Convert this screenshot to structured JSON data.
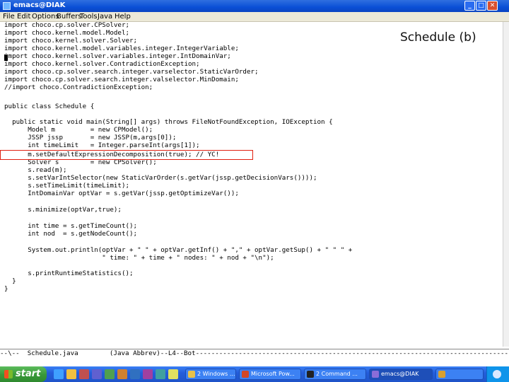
{
  "window": {
    "title": "emacs@DIAK",
    "buttons": [
      "_",
      "□",
      "✕"
    ]
  },
  "menu": {
    "items": [
      "File",
      "Edit",
      "Options",
      "Buffers",
      "Tools",
      "Java",
      "Help"
    ]
  },
  "caption": "Schedule (b)",
  "code": {
    "lines": [
      "import choco.cp.solver.CPSolver;",
      "import choco.kernel.model.Model;",
      "import choco.kernel.solver.Solver;",
      "import choco.kernel.model.variables.integer.IntegerVariable;",
      "import choco.kernel.solver.variables.integer.IntDomainVar;",
      "import choco.kernel.solver.ContradictionException;",
      "import choco.cp.solver.search.integer.varselector.StaticVarOrder;",
      "import choco.cp.solver.search.integer.valselector.MinDomain;",
      "//import choco.ContradictionException;",
      "",
      "public class Schedule {",
      "",
      "  public static void main(String[] args) throws FileNotFoundException, IOException {",
      "      Model m         = new CPModel();",
      "      JSSP jssp       = new JSSP(m,args[0]);",
      "      int timeLimit   = Integer.parseInt(args[1]);",
      "      m.setDefaultExpressionDecomposition(true); // YC!",
      "      Solver s        = new CPSolver();",
      "      s.read(m);",
      "      s.setVarIntSelector(new StaticVarOrder(s.getVar(jssp.getDecisionVars())));",
      "      s.setTimeLimit(timeLimit);",
      "      IntDomainVar optVar = s.getVar(jssp.getOptimizeVar());",
      "",
      "      s.minimize(optVar,true);",
      "",
      "      int time = s.getTimeCount();",
      "      int nod  = s.getNodeCount();",
      "",
      "      System.out.println(optVar + \" \" + optVar.getInf() + \",\" + optVar.getSup() + \" \" \" +",
      "                         \" time: \" + time + \" nodes: \" + nod + \"\\n\");",
      "",
      "      s.printRuntimeStatistics();",
      "  }",
      "}"
    ]
  },
  "modeline": "--\\--  Schedule.java        (Java Abbrev)--L4--Bot----------------------------------------------------------------------------------------",
  "taskbar": {
    "start_label": "start",
    "tasks": [
      {
        "label": "2 Windows ...",
        "color": "#e8c14a"
      },
      {
        "label": "Microsoft Pow...",
        "color": "#d24726"
      },
      {
        "label": "2 Command ...",
        "color": "#222222"
      },
      {
        "label": "emacs@DIAK",
        "color": "#8a6dd8"
      },
      {
        "label": "",
        "color": "#d9a030"
      }
    ]
  },
  "colors": {
    "highlight": "#e02010",
    "titlebar": "#0a4fd6",
    "taskbar": "#245edb",
    "start": "#3a9a3a"
  }
}
